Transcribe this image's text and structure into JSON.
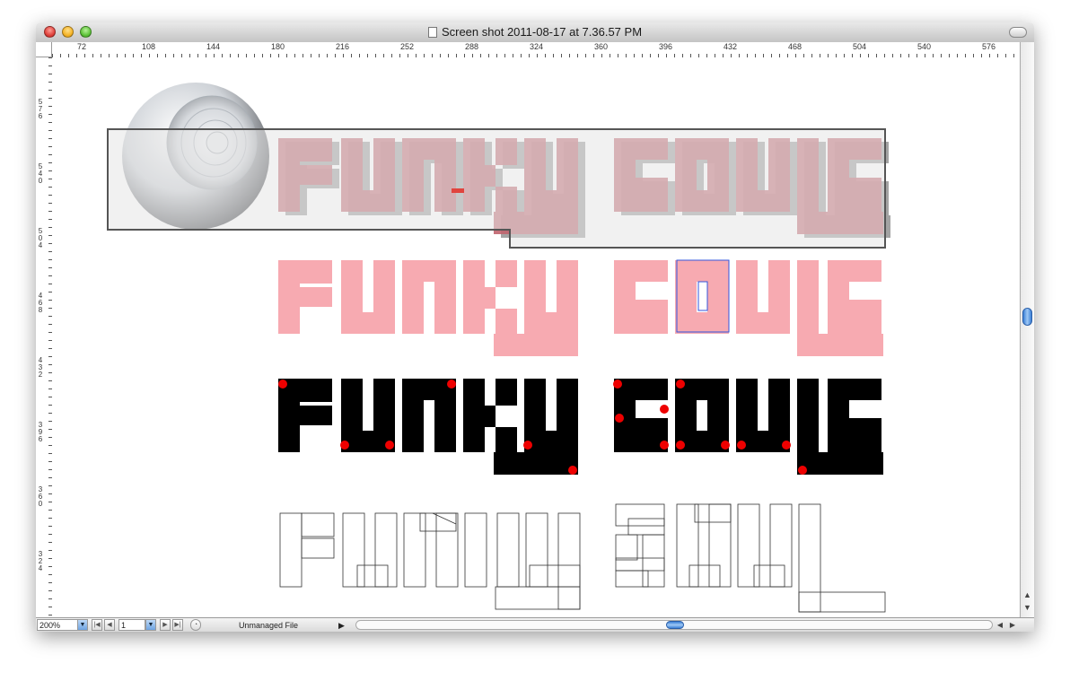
{
  "window": {
    "title": "Screen shot 2011-08-17 at 7.36.57 PM"
  },
  "ruler": {
    "h_labels": [
      "72",
      "108",
      "144",
      "180",
      "216",
      "252",
      "288",
      "324",
      "360",
      "396",
      "432",
      "468",
      "504",
      "540",
      "576"
    ],
    "v_labels": [
      [
        "5",
        "7",
        "6"
      ],
      [
        "5",
        "4",
        "0"
      ],
      [
        "5",
        "0",
        "4"
      ],
      [
        "4",
        "6",
        "8"
      ],
      [
        "4",
        "3",
        "2"
      ],
      [
        "3",
        "9",
        "6"
      ],
      [
        "3",
        "6",
        "0"
      ],
      [
        "3",
        "2",
        "4"
      ]
    ]
  },
  "artwork": {
    "word1": "FUNKY",
    "word2": "SOULS",
    "colors": {
      "pink": "#f7aab1",
      "pink_dark": "#c0646e",
      "shadow": "#9a9a9a",
      "black": "#000000",
      "red_dot": "#ee0000",
      "selection_blue": "#3355dd"
    }
  },
  "status": {
    "zoom": "200%",
    "page": "1",
    "file_status": "Unmanaged File"
  },
  "icons": {
    "first_page": "first-page-icon",
    "prev_page": "prev-page-icon",
    "next_page": "next-page-icon",
    "last_page": "last-page-icon"
  }
}
